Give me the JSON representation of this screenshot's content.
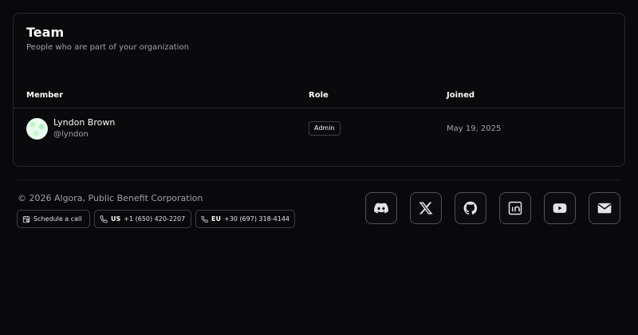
{
  "team": {
    "title": "Team",
    "subtitle": "People who are part of your organization",
    "columns": {
      "member": "Member",
      "role": "Role",
      "joined": "Joined"
    },
    "members": [
      {
        "name": "Lyndon Brown",
        "handle": "@lyndon",
        "role": "Admin",
        "joined": "May 19, 2025",
        "avatar_icon": "identicon-avatar"
      }
    ]
  },
  "footer": {
    "copyright": "© 2026 Algora, Public Benefit Corporation",
    "schedule_label": "Schedule a call",
    "phones": [
      {
        "region": "US",
        "number": "+1 (650) 420-2207"
      },
      {
        "region": "EU",
        "number": "+30 (697) 318-4144"
      }
    ],
    "social_icons": [
      "discord-icon",
      "x-icon",
      "github-icon",
      "linkedin-icon",
      "youtube-icon",
      "mail-icon"
    ]
  },
  "colors": {
    "background": "#09090b",
    "border": "#27272a",
    "muted_text": "#a1a1aa"
  }
}
